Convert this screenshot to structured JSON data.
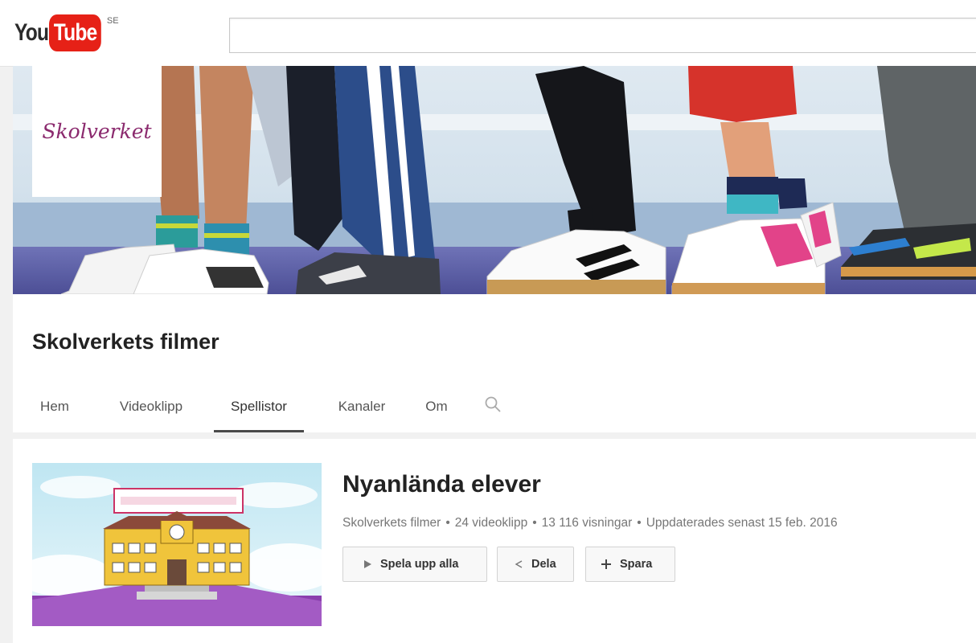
{
  "masthead": {
    "logo_you": "You",
    "logo_tube": "Tube",
    "logo_country": "SE",
    "search_placeholder": ""
  },
  "banner": {
    "channel_logo_text": "Skolverket"
  },
  "channel": {
    "title": "Skolverkets filmer",
    "tabs": [
      {
        "label": "Hem"
      },
      {
        "label": "Videoklipp"
      },
      {
        "label": "Spellistor",
        "active": true
      },
      {
        "label": "Kanaler"
      },
      {
        "label": "Om"
      }
    ]
  },
  "playlist": {
    "title": "Nyanlända elever",
    "meta": {
      "owner": "Skolverkets filmer",
      "videos": "24 videoklipp",
      "views": "13 116 visningar",
      "updated": "Uppdaterades senast 15 feb. 2016",
      "separator": "•"
    },
    "buttons": {
      "play_all": "Spela upp alla",
      "share": "Dela",
      "save": "Spara"
    }
  },
  "colors": {
    "brand_red": "#e62117",
    "logo_purple": "#8b2a6e",
    "text_dark": "#222222",
    "text_meta": "#767676"
  },
  "icons": [
    "play-icon",
    "share-icon",
    "plus-icon",
    "search-icon"
  ]
}
